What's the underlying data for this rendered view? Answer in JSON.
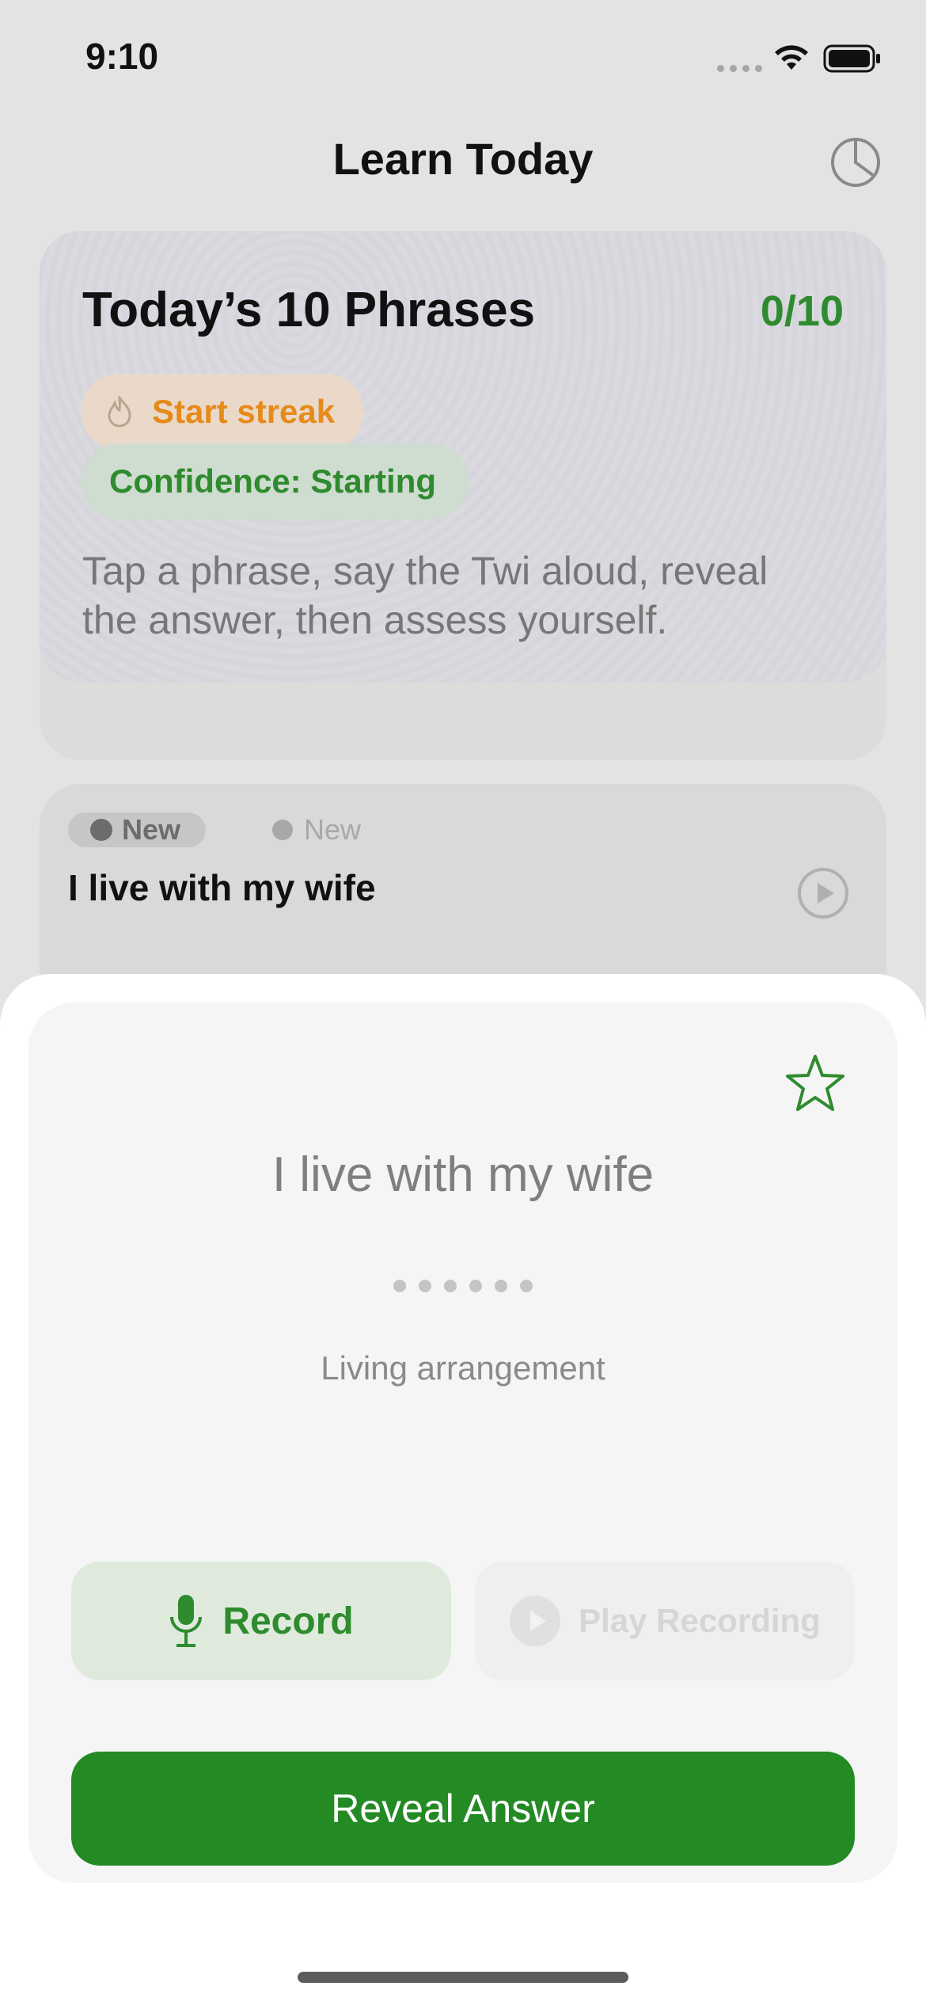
{
  "status_bar": {
    "time": "9:10"
  },
  "nav": {
    "title": "Learn Today",
    "stats_icon": "pie-chart-icon"
  },
  "summary": {
    "title": "Today’s 10 Phrases",
    "progress": "0/10",
    "streak_label": "Start streak",
    "confidence_label": "Confidence: Starting",
    "description": "Tap a phrase, say the Twi aloud, reveal the answer, then assess yourself."
  },
  "phrase_row": {
    "badge_primary": "New",
    "badge_secondary": "New",
    "text": "I live with my wife"
  },
  "card": {
    "phrase": "I live with my wife",
    "hidden_dots": 6,
    "context": "Living arrangement",
    "record_label": "Record",
    "play_label": "Play Recording",
    "reveal_label": "Reveal Answer"
  },
  "colors": {
    "accent_green": "#248a24",
    "streak_orange": "#e68a1a"
  }
}
